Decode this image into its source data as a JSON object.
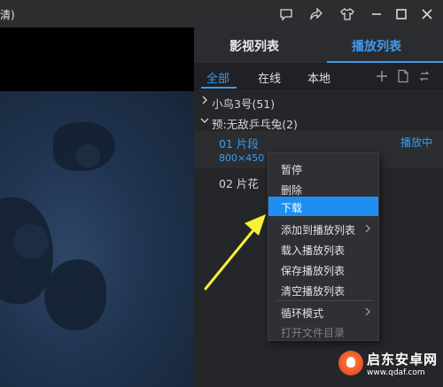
{
  "window": {
    "title_fragment": "清)"
  },
  "panel_tabs": [
    {
      "label": "影视列表"
    },
    {
      "label": "播放列表"
    }
  ],
  "sub_tabs": [
    {
      "label": "全部"
    },
    {
      "label": "在线"
    },
    {
      "label": "本地"
    }
  ],
  "groups": [
    {
      "label": "小鸟3号(51)",
      "expanded": false
    },
    {
      "label": "预:无敌乒乓兔(2)",
      "expanded": true
    }
  ],
  "items": [
    {
      "name": "01 片段",
      "resolution": "800×450",
      "status": "播放中"
    },
    {
      "name": "02 片花"
    }
  ],
  "context_menu": {
    "items": [
      {
        "label": "暂停"
      },
      {
        "label": "删除"
      },
      {
        "label": "下载",
        "highlighted": true
      },
      {
        "label": "添加到播放列表",
        "has_submenu": true
      },
      {
        "label": "载入播放列表"
      },
      {
        "label": "保存播放列表"
      },
      {
        "label": "清空播放列表"
      },
      {
        "label": "循环模式",
        "has_submenu": true
      },
      {
        "label": "打开文件目录",
        "disabled": true
      }
    ]
  },
  "watermark": {
    "title": "启东安卓网",
    "url": "www.qdaf.com"
  },
  "colors": {
    "accent": "#3d9bef",
    "menu_highlight": "#1e8ff0",
    "annotation_arrow": "#f5f23a"
  },
  "icons": [
    "comment-icon",
    "share-icon",
    "skin-icon",
    "minimize-icon",
    "maximize-icon",
    "close-icon",
    "add-icon",
    "file-icon",
    "loop-icon"
  ]
}
